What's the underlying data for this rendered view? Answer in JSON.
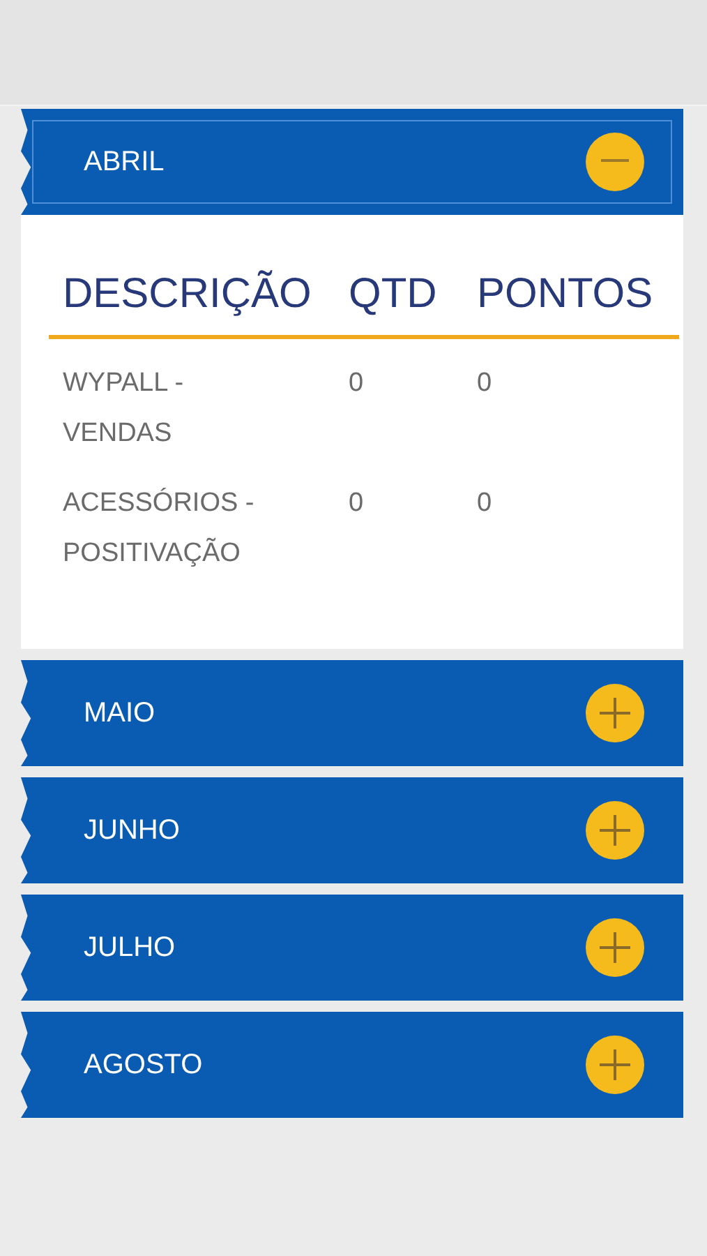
{
  "months": [
    {
      "label": "ABRIL",
      "expanded": true,
      "focused": true,
      "table": {
        "columns": [
          "DESCRIÇÃO",
          "QTD",
          "PONTOS"
        ],
        "rows": [
          {
            "cells": [
              "WYPALL - VENDAS",
              "0",
              "0"
            ]
          },
          {
            "cells": [
              "ACESSÓRIOS - POSITIVAÇÃO",
              "0",
              "0"
            ]
          }
        ]
      }
    },
    {
      "label": "MAIO",
      "expanded": false,
      "focused": false
    },
    {
      "label": "JUNHO",
      "expanded": false,
      "focused": false
    },
    {
      "label": "JULHO",
      "expanded": false,
      "focused": false
    },
    {
      "label": "AGOSTO",
      "expanded": false,
      "focused": false
    }
  ]
}
